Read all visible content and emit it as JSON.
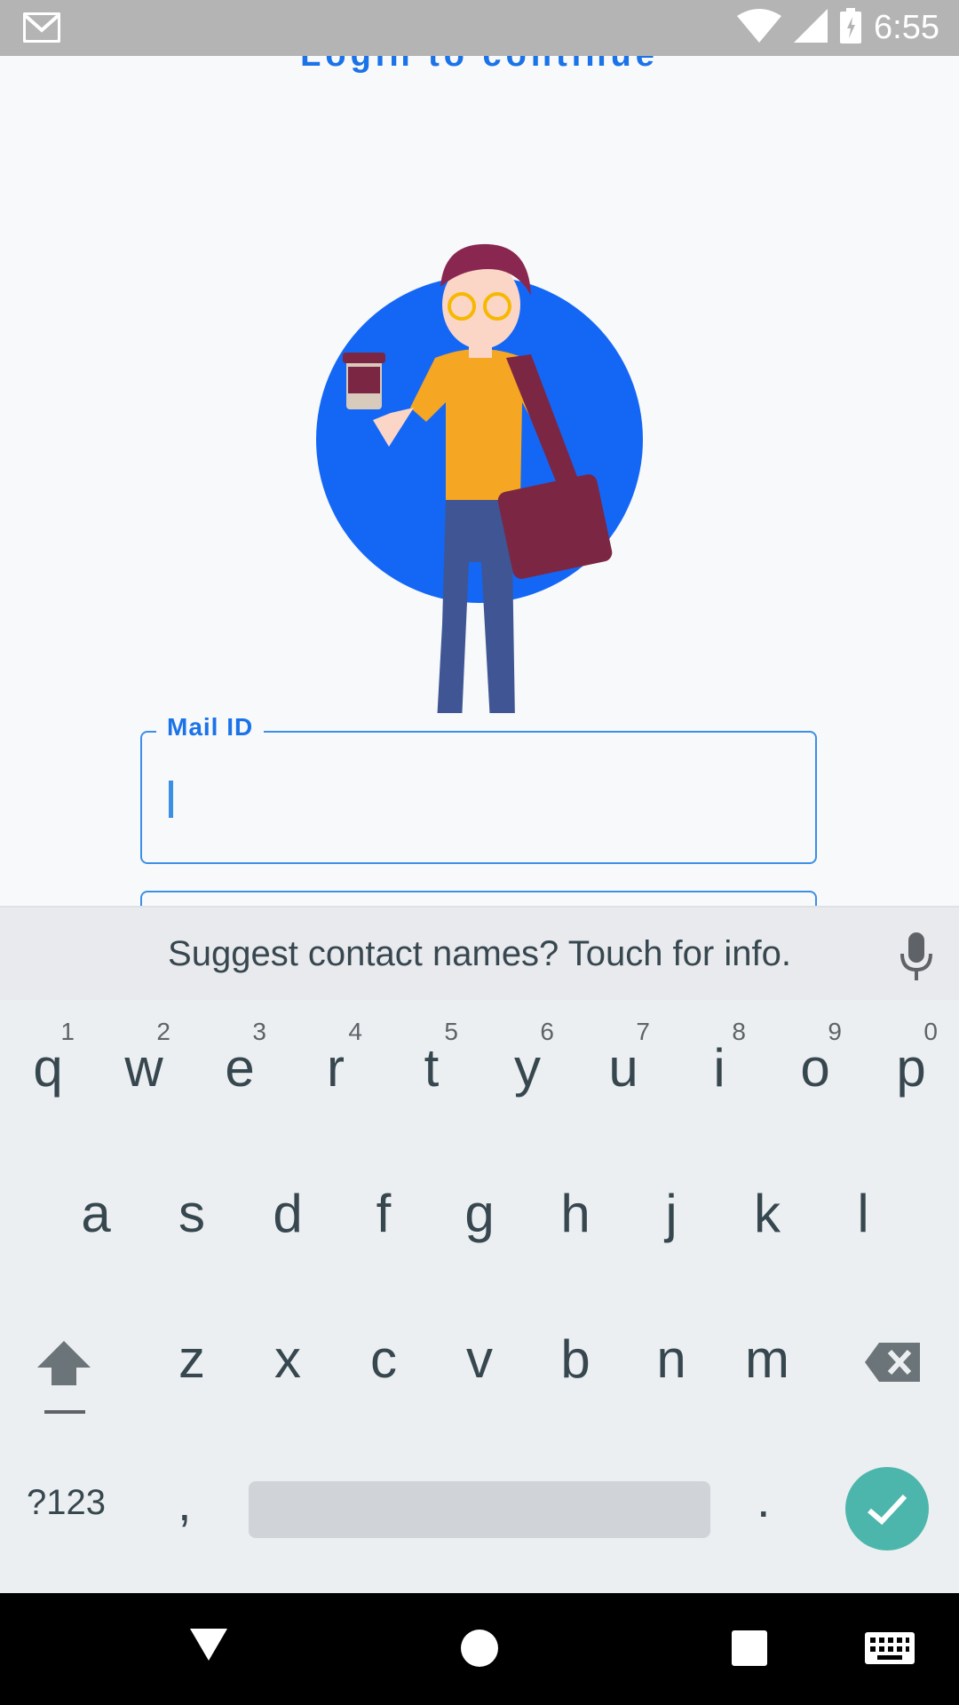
{
  "status_bar": {
    "time": "6:55"
  },
  "screen": {
    "heading": "Login to continue"
  },
  "form": {
    "mail_label": "Mail ID",
    "mail_value": ""
  },
  "keyboard": {
    "suggestion": "Suggest contact names? Touch for info.",
    "row1": [
      {
        "key": "q",
        "hint": "1"
      },
      {
        "key": "w",
        "hint": "2"
      },
      {
        "key": "e",
        "hint": "3"
      },
      {
        "key": "r",
        "hint": "4"
      },
      {
        "key": "t",
        "hint": "5"
      },
      {
        "key": "y",
        "hint": "6"
      },
      {
        "key": "u",
        "hint": "7"
      },
      {
        "key": "i",
        "hint": "8"
      },
      {
        "key": "o",
        "hint": "9"
      },
      {
        "key": "p",
        "hint": "0"
      }
    ],
    "row2": [
      "a",
      "s",
      "d",
      "f",
      "g",
      "h",
      "j",
      "k",
      "l"
    ],
    "row3": [
      "z",
      "x",
      "c",
      "v",
      "b",
      "n",
      "m"
    ],
    "symbols_label": "?123",
    "comma": ",",
    "period": "."
  },
  "colors": {
    "accent": "#1a73e8",
    "enter": "#4db6ac",
    "circle": "#1467f5"
  },
  "icons": [
    "gmail-icon",
    "wifi-icon",
    "signal-icon",
    "battery-icon",
    "mic-icon",
    "shift-icon",
    "backspace-icon",
    "check-icon",
    "back-icon",
    "home-icon",
    "recents-icon",
    "keyboard-icon"
  ]
}
